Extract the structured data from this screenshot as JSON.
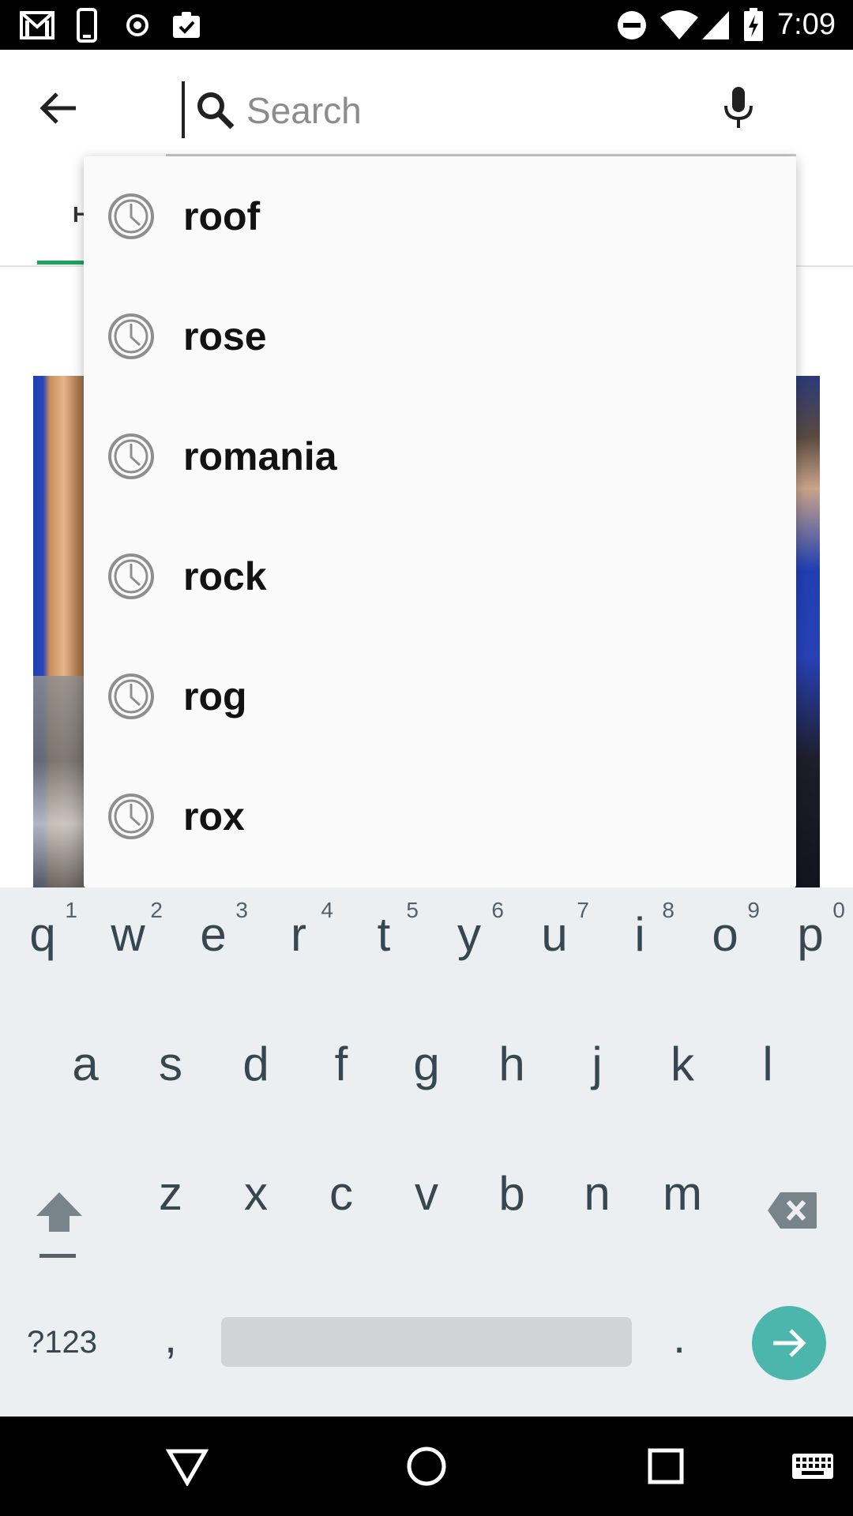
{
  "status_bar": {
    "time": "7:09",
    "left_icons": [
      "gmail-icon",
      "phone-outline-icon",
      "record-icon",
      "clipboard-check-icon"
    ],
    "right_icons": [
      "do-not-disturb-icon",
      "wifi-icon",
      "cell-signal-icon",
      "battery-charging-icon"
    ]
  },
  "search": {
    "placeholder": "Search",
    "value": ""
  },
  "tab": {
    "visible_letter": "H"
  },
  "suggestions": [
    {
      "label": "roof",
      "icon": "history-clock-icon"
    },
    {
      "label": "rose",
      "icon": "history-clock-icon"
    },
    {
      "label": "romania",
      "icon": "history-clock-icon"
    },
    {
      "label": "rock",
      "icon": "history-clock-icon"
    },
    {
      "label": "rog",
      "icon": "history-clock-icon"
    },
    {
      "label": "rox",
      "icon": "history-clock-icon"
    }
  ],
  "keyboard": {
    "row1": [
      {
        "key": "q",
        "hint": "1"
      },
      {
        "key": "w",
        "hint": "2"
      },
      {
        "key": "e",
        "hint": "3"
      },
      {
        "key": "r",
        "hint": "4"
      },
      {
        "key": "t",
        "hint": "5"
      },
      {
        "key": "y",
        "hint": "6"
      },
      {
        "key": "u",
        "hint": "7"
      },
      {
        "key": "i",
        "hint": "8"
      },
      {
        "key": "o",
        "hint": "9"
      },
      {
        "key": "p",
        "hint": "0"
      }
    ],
    "row2": [
      "a",
      "s",
      "d",
      "f",
      "g",
      "h",
      "j",
      "k",
      "l"
    ],
    "row3": [
      "z",
      "x",
      "c",
      "v",
      "b",
      "n",
      "m"
    ],
    "symbols_label": "?123",
    "comma": ",",
    "period": ".",
    "accent_color": "#4db6ac"
  },
  "colors": {
    "tab_indicator": "#1aa55a",
    "keyboard_bg": "#eceff1"
  }
}
